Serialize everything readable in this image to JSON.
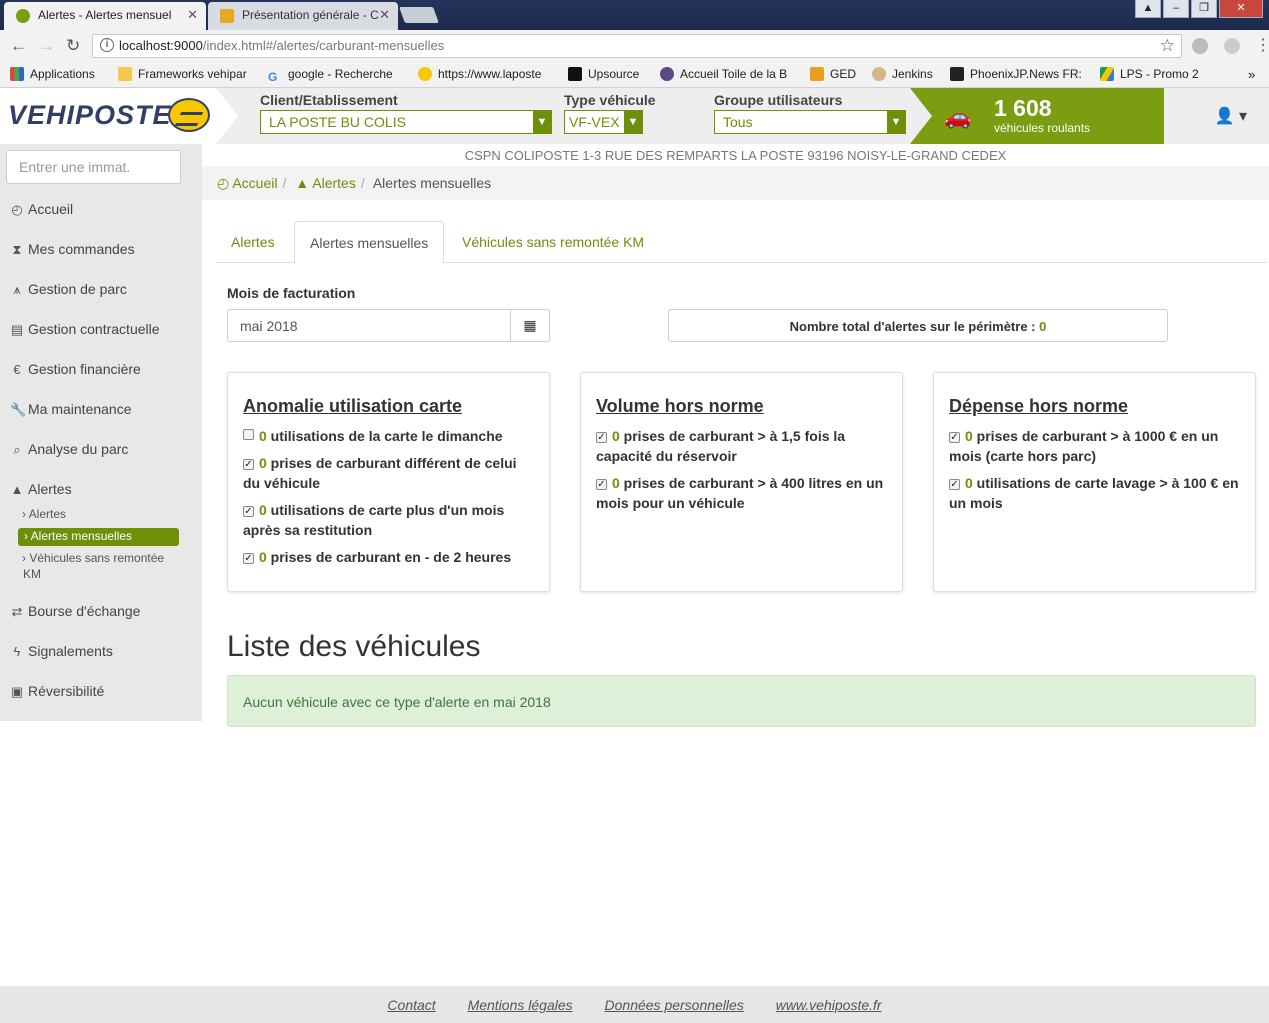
{
  "browser": {
    "tabs": [
      {
        "title": "Alertes - Alertes mensuel",
        "active": true
      },
      {
        "title": "Présentation générale - C",
        "active": false
      }
    ],
    "url_host": "localhost:9000",
    "url_path": "/index.html#/alertes/carburant-mensuelles",
    "bookmarks": [
      "Applications",
      "Frameworks vehipar",
      "google - Recherche",
      "https://www.laposte",
      "Upsource",
      "Accueil Toile de la B",
      "GED",
      "Jenkins",
      "PhoenixJP.News FR:",
      "LPS - Promo 2"
    ]
  },
  "header": {
    "logo_text": "VEHIPOSTE",
    "client_label": "Client/Etablissement",
    "client_value": "LA POSTE BU COLIS",
    "type_label": "Type véhicule",
    "type_value": "VF-VEX",
    "groupe_label": "Groupe utilisateurs",
    "groupe_value": "Tous",
    "fleet_count": "1 608",
    "fleet_label": "véhicules roulants"
  },
  "sidebar": {
    "search_placeholder": "Entrer une immat.",
    "items": [
      {
        "label": "Accueil",
        "icon": "dashboard-icon"
      },
      {
        "label": "Mes commandes",
        "icon": "hourglass-icon"
      },
      {
        "label": "Gestion de parc",
        "icon": "road-icon"
      },
      {
        "label": "Gestion contractuelle",
        "icon": "file-icon"
      },
      {
        "label": "Gestion financière",
        "icon": "euro-icon"
      },
      {
        "label": "Ma maintenance",
        "icon": "wrench-icon"
      },
      {
        "label": "Analyse du parc",
        "icon": "search-icon"
      },
      {
        "label": "Alertes",
        "icon": "warning-icon"
      },
      {
        "label": "Bourse d'échange",
        "icon": "transfer-icon"
      },
      {
        "label": "Signalements",
        "icon": "flash-icon"
      },
      {
        "label": "Réversibilité",
        "icon": "archive-icon"
      }
    ],
    "alert_subitems": [
      "Alertes",
      "Alertes mensuelles",
      "Véhicules sans remontée",
      "KM"
    ]
  },
  "site_address": "CSPN COLIPOSTE 1-3 RUE DES REMPARTS LA POSTE 93196 NOISY-LE-GRAND CEDEX",
  "breadcrumb": {
    "home": "Accueil",
    "alertes": "Alertes",
    "current": "Alertes mensuelles"
  },
  "tabs": [
    "Alertes",
    "Alertes mensuelles",
    "Véhicules sans remontée KM"
  ],
  "filter": {
    "mois_label": "Mois de facturation",
    "mois_value": "mai 2018",
    "total_label": "Nombre total d'alertes sur le périmètre : ",
    "total_value": "0"
  },
  "cards": [
    {
      "title": "Anomalie utilisation carte",
      "rows": [
        {
          "count": "0",
          "text": " utilisations de la carte le dimanche",
          "checked": false
        },
        {
          "count": "0",
          "text": " prises de carburant différent de celui du véhicule",
          "checked": true
        },
        {
          "count": "0",
          "text": " utilisations de carte plus d'un mois après sa restitution",
          "checked": true
        },
        {
          "count": "0",
          "text": " prises de carburant en - de 2 heures",
          "checked": true
        }
      ]
    },
    {
      "title": "Volume hors norme",
      "rows": [
        {
          "count": "0",
          "text": " prises de carburant > à 1,5 fois la capacité du réservoir",
          "checked": true
        },
        {
          "count": "0",
          "text": " prises de carburant > à 400 litres en un mois pour un véhicule",
          "checked": true
        }
      ]
    },
    {
      "title": "Dépense hors norme",
      "rows": [
        {
          "count": "0",
          "text": " prises de carburant > à 1000 € en un mois (carte hors parc)",
          "checked": true
        },
        {
          "count": "0",
          "text": " utilisations de carte lavage > à 100 € en un mois",
          "checked": true
        }
      ]
    }
  ],
  "liste": {
    "title": "Liste des véhicules",
    "empty_message": "Aucun véhicule avec ce type d'alerte en mai 2018"
  },
  "footer": {
    "links": [
      "Contact",
      "Mentions légales",
      "Données personnelles",
      "www.vehiposte.fr"
    ]
  },
  "colors": {
    "accent": "#6e8f0a",
    "fleet_bg": "#7a9d12",
    "success_bg": "#dff0d8"
  }
}
